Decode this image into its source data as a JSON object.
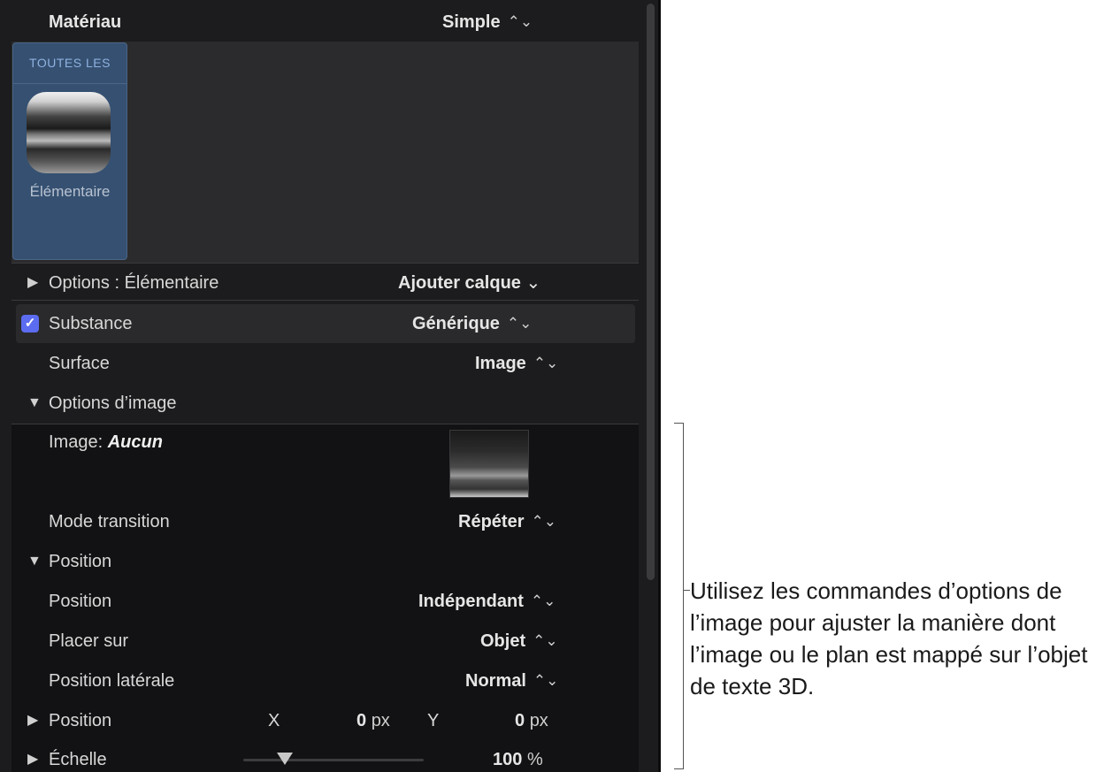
{
  "material": {
    "label": "Matériau",
    "value": "Simple"
  },
  "browser": {
    "category": "TOUTES LES",
    "tile_name": "Élémentaire"
  },
  "options_row": {
    "label": "Options : Élémentaire",
    "add_layer": "Ajouter calque",
    "add_layer_chevron": "⌄"
  },
  "substance": {
    "checked": "✓",
    "label": "Substance",
    "value": "Générique"
  },
  "surface": {
    "label": "Surface",
    "value": "Image"
  },
  "image_options": {
    "label": "Options d’image"
  },
  "image": {
    "label": "Image: ",
    "value": "Aucun"
  },
  "transition": {
    "label": "Mode transition",
    "value": "Répéter"
  },
  "position_group": {
    "label": "Position"
  },
  "position_mode": {
    "label": "Position",
    "value": "Indépendant"
  },
  "place_on": {
    "label": "Placer sur",
    "value": "Objet"
  },
  "side_position": {
    "label": "Position latérale",
    "value": "Normal"
  },
  "position_xy": {
    "label": "Position",
    "x_label": "X",
    "x_value": "0",
    "y_label": "Y",
    "y_value": "0",
    "unit": "px"
  },
  "scale": {
    "label": "Échelle",
    "value": "100",
    "unit": "%",
    "slider_fraction": 0.23
  },
  "glyphs": {
    "updown": "⌃⌄",
    "tri_right": "▶",
    "tri_down": "▼"
  },
  "callout": "Utilisez les commandes d’options de l’image pour ajuster la manière dont l’image ou le plan est mappé sur l’objet de texte 3D."
}
